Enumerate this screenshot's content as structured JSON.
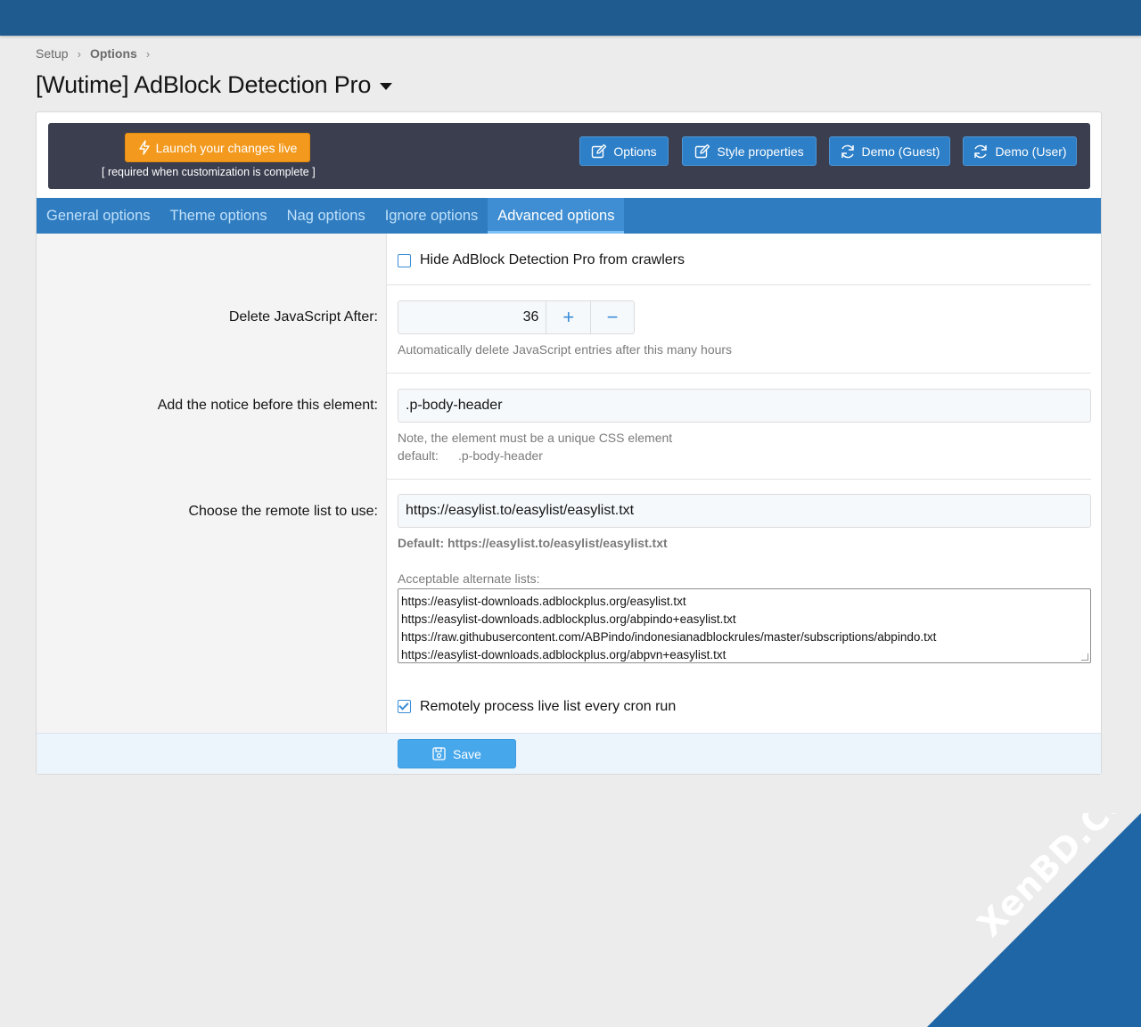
{
  "breadcrumb": {
    "items": [
      "Setup",
      "Options"
    ]
  },
  "page": {
    "title": "[Wutime] AdBlock Detection Pro"
  },
  "launch": {
    "button_label": "Launch your changes live",
    "note": "[ required when customization is complete ]"
  },
  "header_buttons": [
    {
      "label": "Options",
      "icon": "edit-icon"
    },
    {
      "label": "Style properties",
      "icon": "edit-icon"
    },
    {
      "label": "Demo (Guest)",
      "icon": "refresh-icon"
    },
    {
      "label": "Demo (User)",
      "icon": "refresh-icon"
    }
  ],
  "tabs": [
    {
      "label": "General options",
      "active": false
    },
    {
      "label": "Theme options",
      "active": false
    },
    {
      "label": "Nag options",
      "active": false
    },
    {
      "label": "Ignore options",
      "active": false
    },
    {
      "label": "Advanced options",
      "active": true
    }
  ],
  "form": {
    "hide_crawlers": {
      "label": "Hide AdBlock Detection Pro from crawlers",
      "checked": false
    },
    "delete_js": {
      "label": "Delete JavaScript After:",
      "value": "36",
      "plus": "+",
      "minus": "−",
      "hint": "Automatically delete JavaScript entries after this many hours"
    },
    "notice_element": {
      "label": "Add the notice before this element:",
      "value": ".p-body-header",
      "hint": "Note, the element must be a unique CSS element",
      "default_label": "default:",
      "default_value": ".p-body-header"
    },
    "remote_list": {
      "label": "Choose the remote list to use:",
      "value": "https://easylist.to/easylist/easylist.txt",
      "default_hint": "Default: https://easylist.to/easylist/easylist.txt",
      "alternates_label": "Acceptable alternate lists:",
      "alternates": [
        "https://easylist-downloads.adblockplus.org/easylist.txt",
        "https://easylist-downloads.adblockplus.org/abpindo+easylist.txt",
        "https://raw.githubusercontent.com/ABPindo/indonesianadblockrules/master/subscriptions/abpindo.txt",
        "https://easylist-downloads.adblockplus.org/abpvn+easylist.txt"
      ]
    },
    "process_cron": {
      "label": "Remotely process live list every cron run",
      "checked": true
    }
  },
  "footer": {
    "save_label": "Save"
  },
  "watermark": {
    "text": "XenBD.Com"
  },
  "colors": {
    "topbar": "#1f5b8e",
    "tab_bar": "#2f7cc0",
    "launch": "#f39a1e",
    "accent": "#3a8dd6"
  }
}
